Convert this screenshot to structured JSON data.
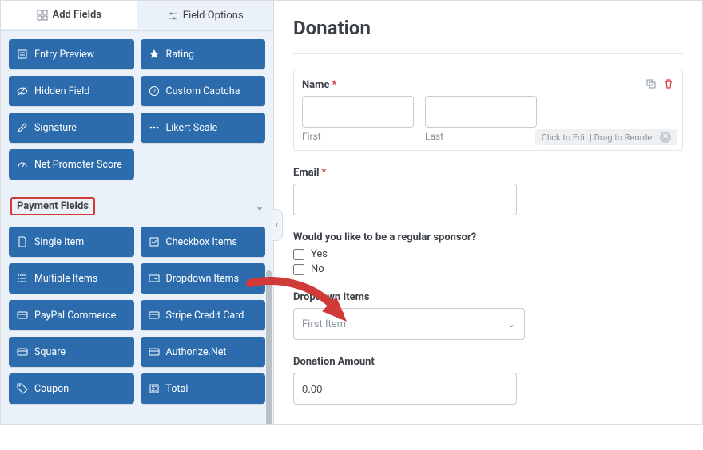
{
  "tabs": {
    "add_fields": "Add Fields",
    "field_options": "Field Options"
  },
  "sidebar": {
    "fancy_fields": [
      {
        "icon": "entry-preview-icon",
        "label": "Entry Preview"
      },
      {
        "icon": "star-icon",
        "label": "Rating"
      },
      {
        "icon": "eye-off-icon",
        "label": "Hidden Field"
      },
      {
        "icon": "help-circle-icon",
        "label": "Custom Captcha"
      },
      {
        "icon": "pencil-icon",
        "label": "Signature"
      },
      {
        "icon": "dots-icon",
        "label": "Likert Scale"
      },
      {
        "icon": "gauge-icon",
        "label": "Net Promoter Score"
      }
    ],
    "payment_section_title": "Payment Fields",
    "payment_fields": [
      {
        "icon": "file-icon",
        "label": "Single Item"
      },
      {
        "icon": "check-square-icon",
        "label": "Checkbox Items"
      },
      {
        "icon": "list-icon",
        "label": "Multiple Items"
      },
      {
        "icon": "dropdown-icon",
        "label": "Dropdown Items"
      },
      {
        "icon": "card-icon",
        "label": "PayPal Commerce"
      },
      {
        "icon": "card-icon",
        "label": "Stripe Credit Card"
      },
      {
        "icon": "card-icon",
        "label": "Square"
      },
      {
        "icon": "card-icon",
        "label": "Authorize.Net"
      },
      {
        "icon": "tag-icon",
        "label": "Coupon"
      },
      {
        "icon": "sigma-icon",
        "label": "Total"
      }
    ]
  },
  "form": {
    "title": "Donation",
    "name": {
      "label": "Name",
      "first": "First",
      "last": "Last",
      "hint": "Click to Edit | Drag to Reorder"
    },
    "email_label": "Email",
    "sponsor": {
      "label": "Would you like to be a regular sponsor?",
      "options": [
        "Yes",
        "No"
      ]
    },
    "dropdown_items": {
      "label": "Dropdown Items",
      "selected": "First Item"
    },
    "amount": {
      "label": "Donation Amount",
      "value": "0.00"
    }
  },
  "colors": {
    "accent_button": "#2c6cad",
    "highlight": "#d23a3a",
    "panel_bg": "#eaf1f8"
  }
}
